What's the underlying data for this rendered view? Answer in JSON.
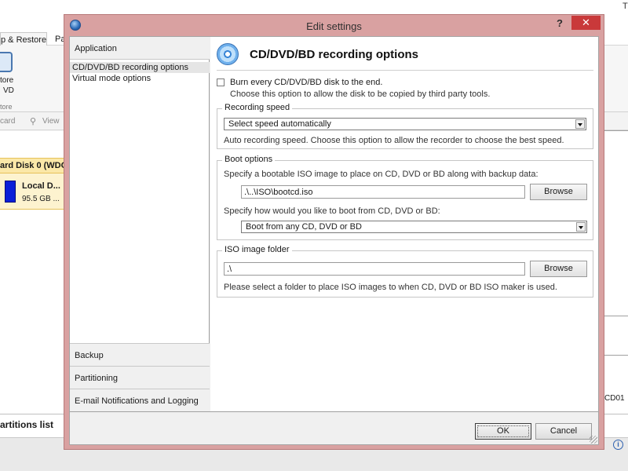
{
  "background": {
    "ribbon_tab_active": "p & Restore",
    "ribbon_tab_next": "Pa",
    "restore_label": "tore",
    "restore_sublabel": "VD",
    "group_label": "tore",
    "toolbar_discard": "card",
    "toolbar_view": "View",
    "disk_header": "ard Disk 0 (WDC",
    "partition_name": "Local D...",
    "partition_size": "95.5 GB ...",
    "right_label": "CD01",
    "partitions_list_title": "artitions list",
    "status_info_glyph": "i",
    "top_right_glyph": "T"
  },
  "dialog": {
    "title": "Edit settings",
    "help_label": "?",
    "close_label": "✕",
    "nav": {
      "header": "Application",
      "items": [
        {
          "label": "CD/DVD/BD recording options",
          "selected": true
        },
        {
          "label": "Virtual mode options",
          "selected": false
        }
      ],
      "groups": [
        "Backup",
        "Partitioning",
        "E-mail Notifications and Logging"
      ]
    },
    "panel": {
      "title": "CD/DVD/BD recording options",
      "burn_checkbox_label": "Burn every CD/DVD/BD disk to the end.",
      "burn_checked": false,
      "burn_description": "Choose this option to allow the disk to be copied by third party tools.",
      "recording_speed": {
        "legend": "Recording speed",
        "selected": "Select speed automatically",
        "description": "Auto recording speed. Choose this option to allow the recorder to choose the best speed."
      },
      "boot_options": {
        "legend": "Boot options",
        "iso_prompt": "Specify a bootable ISO image to place on CD, DVD or BD along with backup data:",
        "iso_path": ".\\..\\ISO\\bootcd.iso",
        "browse_label": "Browse",
        "boot_prompt": "Specify how would you like to boot from CD, DVD or BD:",
        "boot_selected": "Boot from any CD, DVD or BD"
      },
      "iso_folder": {
        "legend": "ISO image folder",
        "path": ".\\",
        "browse_label": "Browse",
        "description": "Please select a folder to place ISO images to when CD, DVD or BD ISO maker is used."
      }
    },
    "ok_label": "OK",
    "cancel_label": "Cancel"
  },
  "colors": {
    "dialog_frame": "#d9a1a1",
    "close_button": "#c9393a",
    "partition_bar": "#0a1fd8",
    "disk_highlight": "#fbe8a8"
  }
}
